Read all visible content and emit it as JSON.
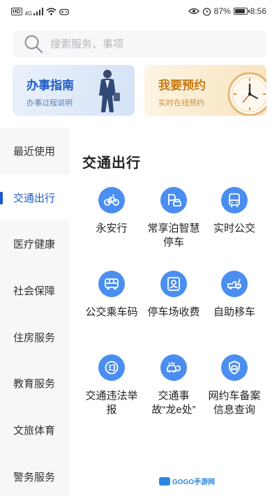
{
  "status_bar": {
    "hd": "HD",
    "network": "4G",
    "battery_text": "87%",
    "battery_level": 0.87,
    "time": "8:56"
  },
  "search": {
    "placeholder": "搜索服务、事项"
  },
  "cards": {
    "guide": {
      "title": "办事指南",
      "subtitle": "办事过程说明"
    },
    "booking": {
      "title": "我要预约",
      "subtitle": "实时在线预约"
    }
  },
  "sidebar": {
    "items": [
      {
        "label": "最近使用"
      },
      {
        "label": "交通出行",
        "active": true
      },
      {
        "label": "医疗健康"
      },
      {
        "label": "社会保障"
      },
      {
        "label": "住房服务"
      },
      {
        "label": "教育服务"
      },
      {
        "label": "文旅体育"
      },
      {
        "label": "警务服务"
      }
    ]
  },
  "main": {
    "title": "交通出行",
    "services": [
      {
        "label": "永安行",
        "icon": "bicycle-icon"
      },
      {
        "label": "常享泊智慧停车",
        "icon": "parking-car-icon"
      },
      {
        "label": "实时公交",
        "icon": "bus-front-icon"
      },
      {
        "label": "公交乘车码",
        "icon": "bus-side-icon"
      },
      {
        "label": "停车场收费",
        "icon": "parking-fee-icon"
      },
      {
        "label": "自助移车",
        "icon": "tow-truck-icon"
      },
      {
        "label": "交通违法举报",
        "icon": "violation-report-icon"
      },
      {
        "label": "交通事故“龙e处”",
        "icon": "accident-car-icon"
      },
      {
        "label": "网约车备案信息查询",
        "icon": "ride-hailing-icon"
      }
    ]
  },
  "watermark": {
    "text": "GOGO手游网"
  },
  "colors": {
    "accent": "#1e5ac8",
    "icon_bg": "#4a8ef0",
    "booking": "#c67a13"
  }
}
